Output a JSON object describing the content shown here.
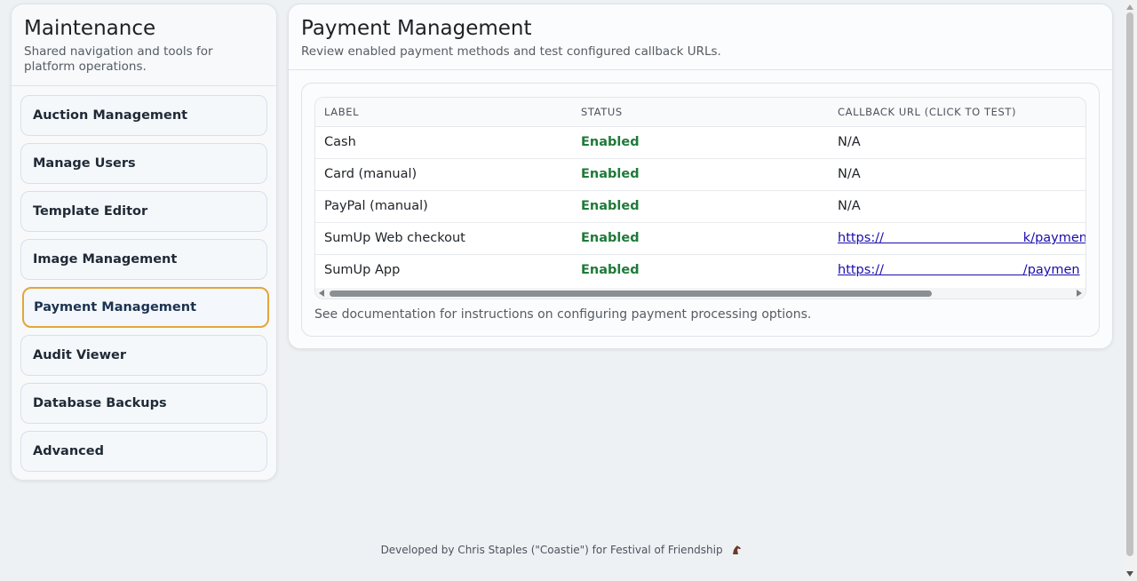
{
  "sidebar": {
    "title": "Maintenance",
    "subtitle": "Shared navigation and tools for platform operations.",
    "items": [
      {
        "label": "Auction Management"
      },
      {
        "label": "Manage Users"
      },
      {
        "label": "Template Editor"
      },
      {
        "label": "Image Management"
      },
      {
        "label": "Payment Management",
        "active": true
      },
      {
        "label": "Audit Viewer"
      },
      {
        "label": "Database Backups"
      },
      {
        "label": "Advanced"
      }
    ]
  },
  "main": {
    "title": "Payment Management",
    "subtitle": "Review enabled payment methods and test configured callback URLs.",
    "table": {
      "headers": [
        "LABEL",
        "STATUS",
        "CALLBACK URL (CLICK TO TEST)"
      ],
      "rows": [
        {
          "label": "Cash",
          "status": "Enabled",
          "callback": "N/A"
        },
        {
          "label": "Card (manual)",
          "status": "Enabled",
          "callback": "N/A"
        },
        {
          "label": "PayPal (manual)",
          "status": "Enabled",
          "callback": "N/A"
        },
        {
          "label": "SumUp Web checkout",
          "status": "Enabled",
          "callback": "https://                 k/paymen"
        },
        {
          "label": "SumUp App",
          "status": "Enabled",
          "callback": "https://                 /paymen"
        }
      ]
    },
    "note": "See documentation for instructions on configuring payment processing options."
  },
  "footer": {
    "text": "Developed by Chris Staples (\"Coastie\") for Festival of Friendship",
    "icon": "horse-icon"
  },
  "colors": {
    "accent_active_border": "#e3a63a",
    "status_enabled": "#1f7a3a",
    "link": "#1a0dab"
  }
}
